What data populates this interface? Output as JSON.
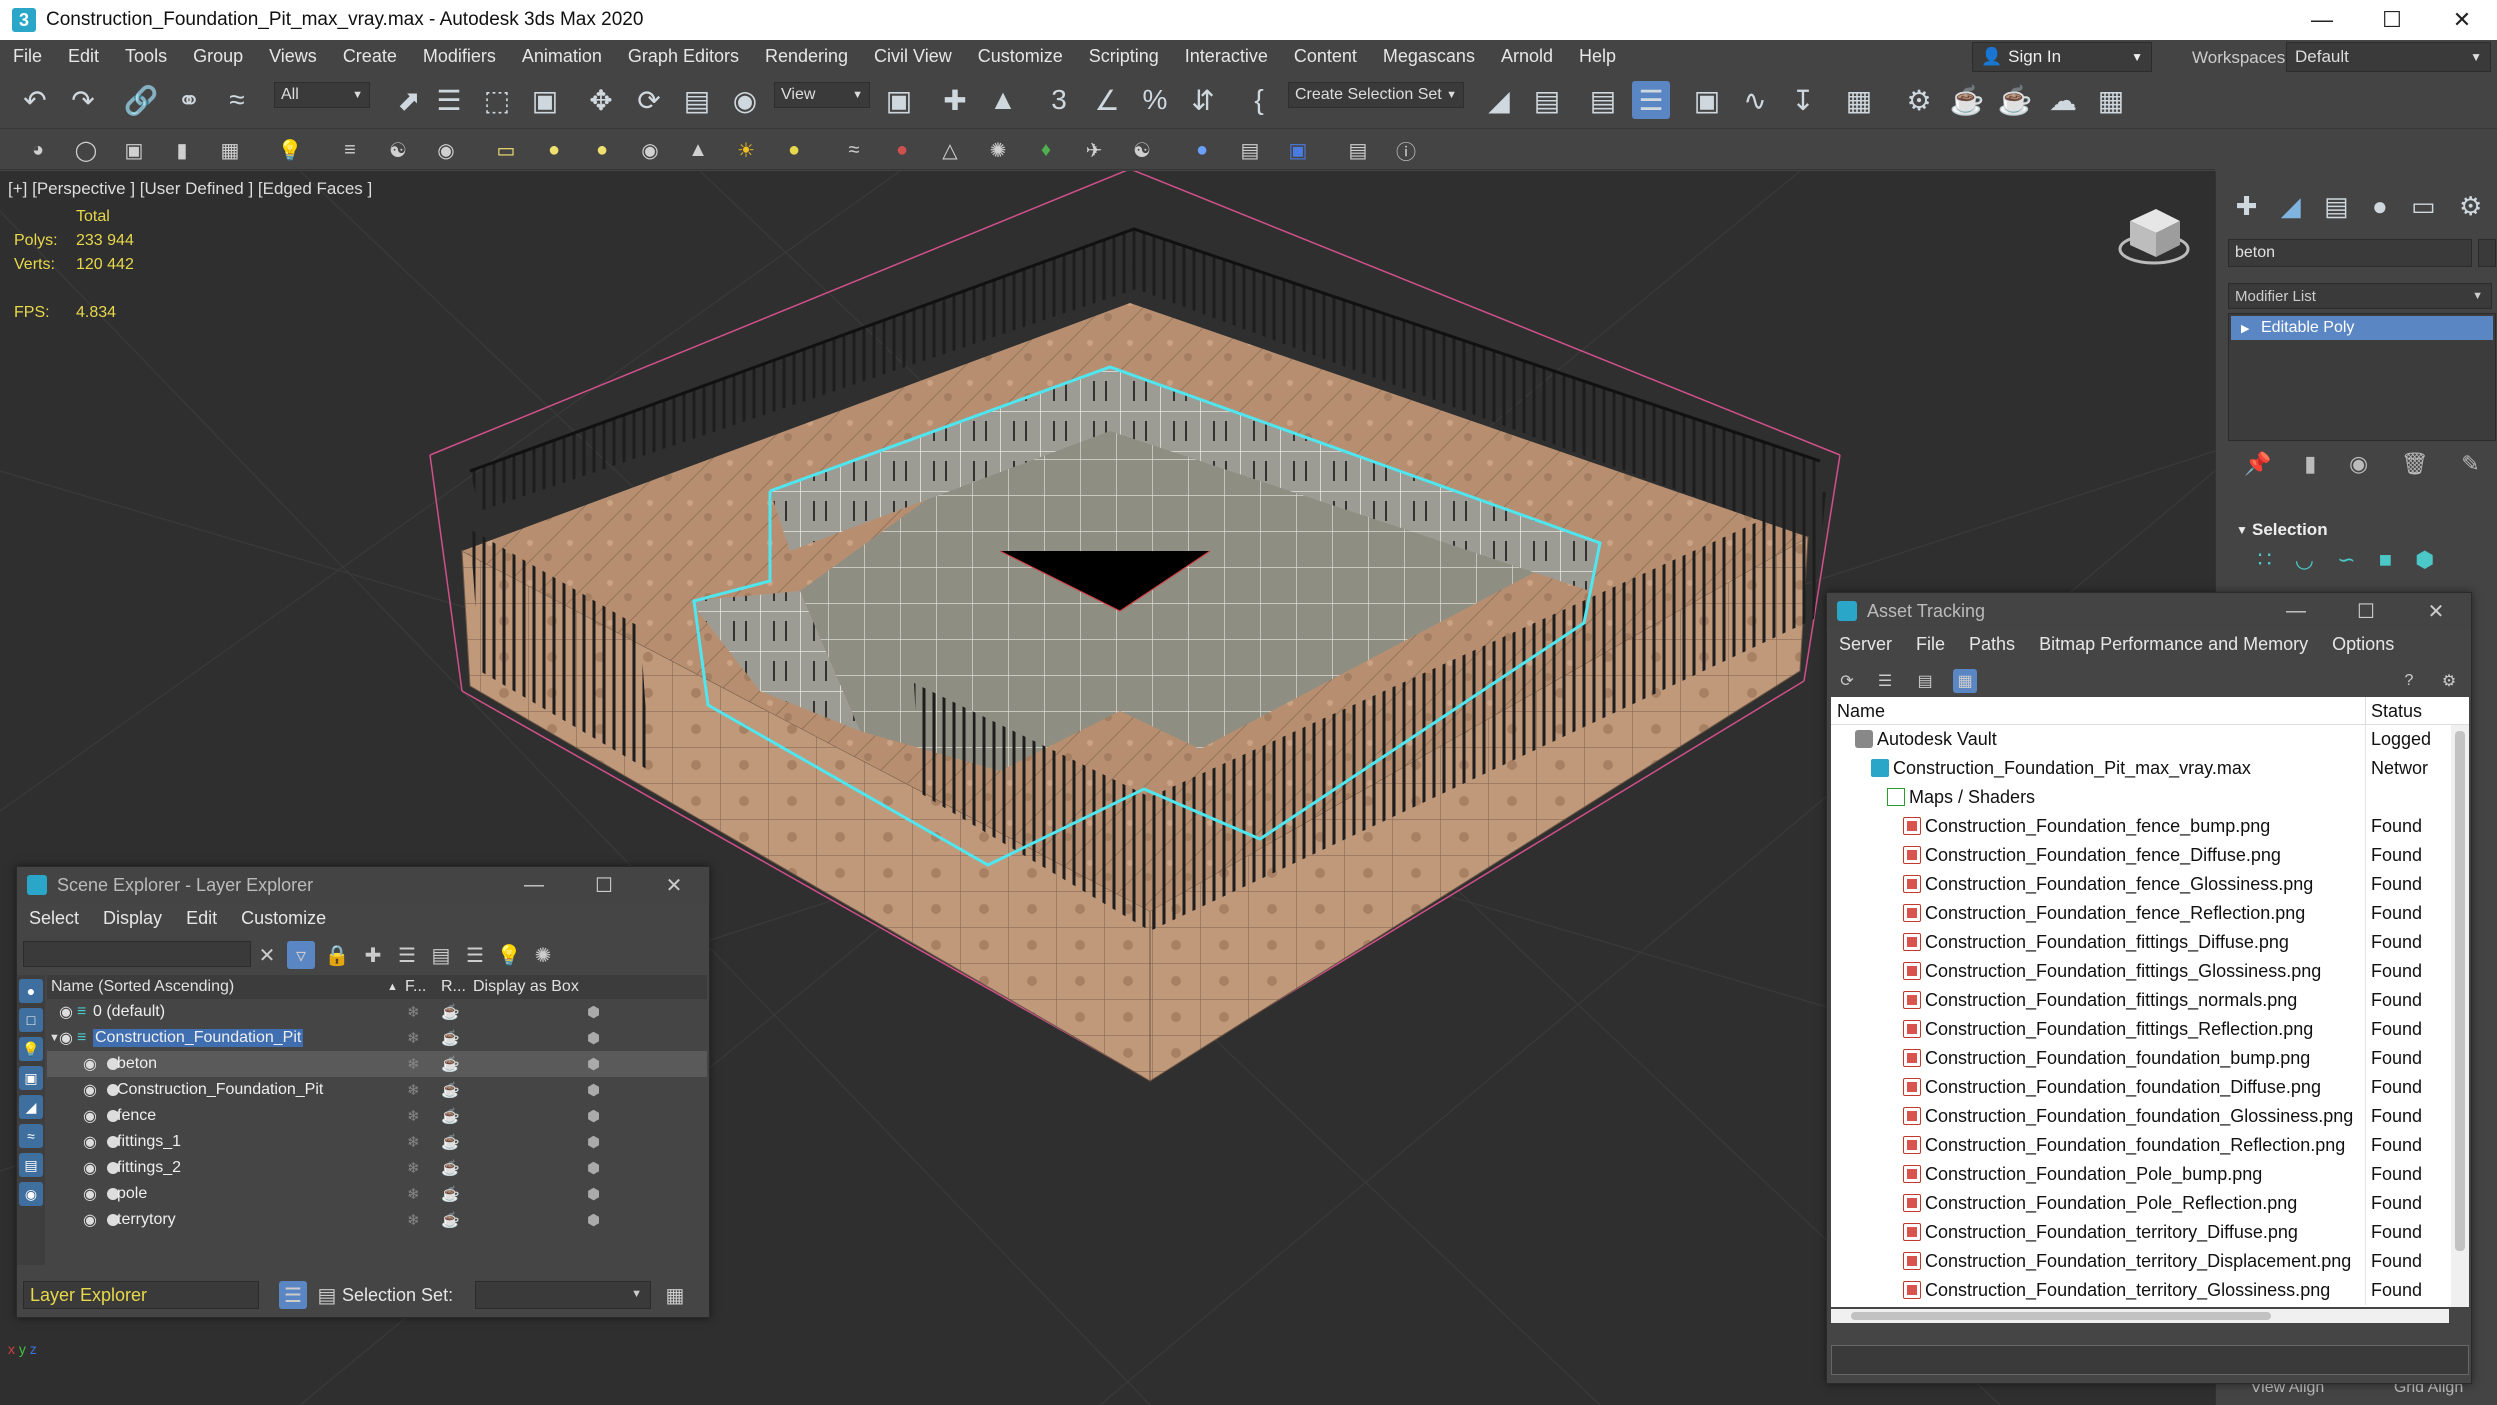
{
  "window": {
    "title": "Construction_Foundation_Pit_max_vray.max - Autodesk 3ds Max 2020",
    "app_icon": "3"
  },
  "menu": [
    "File",
    "Edit",
    "Tools",
    "Group",
    "Views",
    "Create",
    "Modifiers",
    "Animation",
    "Graph Editors",
    "Rendering",
    "Civil View",
    "Customize",
    "Scripting",
    "Interactive",
    "Content",
    "Megascans",
    "Arnold",
    "Help"
  ],
  "signin": {
    "label": "Sign In"
  },
  "workspaces": {
    "label": "Workspaces:",
    "value": "Default"
  },
  "toolbar": {
    "selection_filter": "All",
    "reference_coord": "View",
    "create_selection_set": "Create Selection Set"
  },
  "viewport": {
    "label": "[+] [Perspective ] [User Defined ] [Edged Faces ]",
    "stats": {
      "total_label": "Total",
      "polys_label": "Polys:",
      "polys_value": "233 944",
      "verts_label": "Verts:",
      "verts_value": "120 442",
      "fps_label": "FPS:",
      "fps_value": "4.834"
    },
    "gizmo": {
      "x": "x",
      "y": "y",
      "z": "z"
    }
  },
  "command_panel": {
    "object_name": "beton",
    "modifier_list": "Modifier List",
    "stack_item": "Editable Poly",
    "selection_rollout": "Selection",
    "bottom_left": "View Align",
    "bottom_right": "Grid Align"
  },
  "scene_explorer": {
    "title": "Scene Explorer - Layer Explorer",
    "menu": [
      "Select",
      "Display",
      "Edit",
      "Customize"
    ],
    "columns": {
      "name": "Name (Sorted Ascending)",
      "frozen": "F...",
      "render": "R...",
      "box": "Display as Box"
    },
    "rows": [
      {
        "name": "0 (default)",
        "indent": 0,
        "kind": "layer"
      },
      {
        "name": "Construction_Foundation_Pit",
        "indent": 0,
        "kind": "layer-active"
      },
      {
        "name": "beton",
        "indent": 1,
        "kind": "object-selected"
      },
      {
        "name": "Construction_Foundation_Pit",
        "indent": 1,
        "kind": "object-group"
      },
      {
        "name": "fence",
        "indent": 1,
        "kind": "object"
      },
      {
        "name": "fittings_1",
        "indent": 1,
        "kind": "object"
      },
      {
        "name": "fittings_2",
        "indent": 1,
        "kind": "object"
      },
      {
        "name": "pole",
        "indent": 1,
        "kind": "object"
      },
      {
        "name": "terrytory",
        "indent": 1,
        "kind": "object"
      }
    ],
    "layer_explorer": "Layer Explorer",
    "selection_set_label": "Selection Set:"
  },
  "asset_tracking": {
    "title": "Asset Tracking",
    "menu": [
      "Server",
      "File",
      "Paths",
      "Bitmap Performance and Memory",
      "Options"
    ],
    "columns": {
      "name": "Name",
      "status": "Status"
    },
    "rows": [
      {
        "name": "Autodesk Vault",
        "status": "Logged",
        "indent": 1,
        "icon": "vault"
      },
      {
        "name": "Construction_Foundation_Pit_max_vray.max",
        "status": "Networ",
        "indent": 2,
        "icon": "max"
      },
      {
        "name": "Maps / Shaders",
        "status": "",
        "indent": 3,
        "icon": "maps"
      },
      {
        "name": "Construction_Foundation_fence_bump.png",
        "status": "Found",
        "indent": 4,
        "icon": "png"
      },
      {
        "name": "Construction_Foundation_fence_Diffuse.png",
        "status": "Found",
        "indent": 4,
        "icon": "png"
      },
      {
        "name": "Construction_Foundation_fence_Glossiness.png",
        "status": "Found",
        "indent": 4,
        "icon": "png"
      },
      {
        "name": "Construction_Foundation_fence_Reflection.png",
        "status": "Found",
        "indent": 4,
        "icon": "png"
      },
      {
        "name": "Construction_Foundation_fittings_Diffuse.png",
        "status": "Found",
        "indent": 4,
        "icon": "png"
      },
      {
        "name": "Construction_Foundation_fittings_Glossiness.png",
        "status": "Found",
        "indent": 4,
        "icon": "png"
      },
      {
        "name": "Construction_Foundation_fittings_normals.png",
        "status": "Found",
        "indent": 4,
        "icon": "png"
      },
      {
        "name": "Construction_Foundation_fittings_Reflection.png",
        "status": "Found",
        "indent": 4,
        "icon": "png"
      },
      {
        "name": "Construction_Foundation_foundation_bump.png",
        "status": "Found",
        "indent": 4,
        "icon": "png"
      },
      {
        "name": "Construction_Foundation_foundation_Diffuse.png",
        "status": "Found",
        "indent": 4,
        "icon": "png"
      },
      {
        "name": "Construction_Foundation_foundation_Glossiness.png",
        "status": "Found",
        "indent": 4,
        "icon": "png"
      },
      {
        "name": "Construction_Foundation_foundation_Reflection.png",
        "status": "Found",
        "indent": 4,
        "icon": "png"
      },
      {
        "name": "Construction_Foundation_Pole_bump.png",
        "status": "Found",
        "indent": 4,
        "icon": "png"
      },
      {
        "name": "Construction_Foundation_Pole_Reflection.png",
        "status": "Found",
        "indent": 4,
        "icon": "png"
      },
      {
        "name": "Construction_Foundation_territory_Diffuse.png",
        "status": "Found",
        "indent": 4,
        "icon": "png"
      },
      {
        "name": "Construction_Foundation_territory_Displacement.png",
        "status": "Found",
        "indent": 4,
        "icon": "png"
      },
      {
        "name": "Construction_Foundation_territory_Glossiness.png",
        "status": "Found",
        "indent": 4,
        "icon": "png"
      }
    ]
  },
  "colors": {
    "accent_blue": "#5b86c4",
    "stats_yellow": "#e8d84b",
    "selection_cyan": "#4fe6f0",
    "bbox_pink": "#d0508a"
  }
}
